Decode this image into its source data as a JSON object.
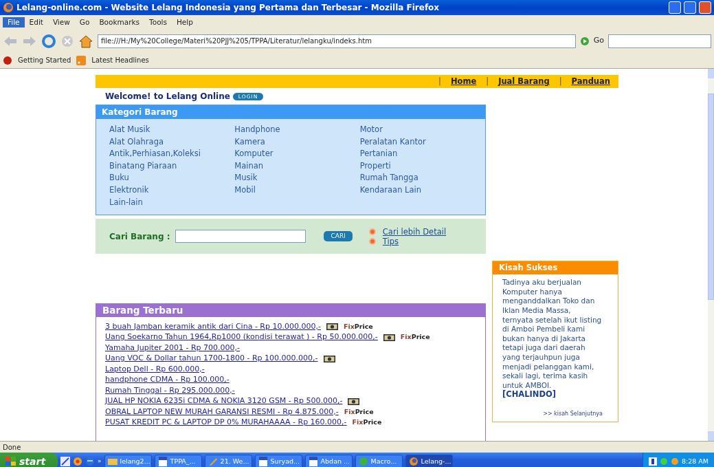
{
  "window": {
    "title": "Lelang-online.com - Website Lelang Indonesia yang Pertama dan Terbesar - Mozilla Firefox"
  },
  "menu": [
    {
      "label": "File",
      "selected": true
    },
    {
      "label": "Edit",
      "selected": false
    },
    {
      "label": "View",
      "selected": false
    },
    {
      "label": "Go",
      "selected": false
    },
    {
      "label": "Bookmarks",
      "selected": false
    },
    {
      "label": "Tools",
      "selected": false
    },
    {
      "label": "Help",
      "selected": false
    }
  ],
  "address": {
    "value": "file:///H:/My%20College/Materi%20PJJ%205/TPPA/Literatur/lelangku/indeks.htm",
    "go": "Go"
  },
  "bookmarks": [
    {
      "label": "Getting Started",
      "kind": "page"
    },
    {
      "label": "Latest Headlines",
      "kind": "feed"
    }
  ],
  "page": {
    "nav": [
      {
        "separator": "|",
        "label": "Home"
      },
      {
        "separator": "|",
        "label": "Jual Barang"
      },
      {
        "separator": "|",
        "label": "Panduan"
      }
    ],
    "welcome": "Welcome! to Lelang Online",
    "login": "LOGIN",
    "kategori": {
      "title": "Kategori Barang",
      "columns": [
        [
          "Alat Musik",
          "Alat Olahraga",
          "Antik,Perhiasan,Koleksi",
          "Binatang Piaraan",
          "Buku",
          "Elektronik",
          "Lain-lain"
        ],
        [
          "Handphone",
          "Kamera",
          "Komputer",
          "Mainan",
          "Musik",
          "Mobil"
        ],
        [
          "Motor",
          "Peralatan Kantor",
          "Pertanian",
          "Properti",
          "Rumah Tangga",
          "Kendaraan Lain"
        ]
      ]
    },
    "search": {
      "label": "Cari Barang :",
      "button": "CARI",
      "links": [
        "Cari lebih Detail",
        "Tips"
      ]
    },
    "terbaru": {
      "title": "Barang Terbaru",
      "items": [
        {
          "text": "3 buah Jamban keramik antik dari Cina - Rp 10.000.000,-",
          "photo": true,
          "fix": "Fix",
          "price": "Price"
        },
        {
          "text": "Uang Soekarno Tahun 1964,Rp1000 (kondisi terawat ) - Rp 50.000.000,-",
          "photo": true,
          "fix": "Fix",
          "price": "Price"
        },
        {
          "text": "Yamaha Jupiter 2001 - Rp 700.000,-",
          "photo": false
        },
        {
          "text": "Uang VOC & Dollar tahun 1700-1800 - Rp 100.000.000,-",
          "photo": true
        },
        {
          "text": "Laptop Dell - Rp 600.000,-",
          "photo": false
        },
        {
          "text": "handphone CDMA - Rp 100.000,-",
          "photo": false
        },
        {
          "text": "Rumah Tinggal - Rp 295.000.000,-",
          "photo": false
        },
        {
          "text": "JUAL HP NOKIA 6235i CDMA & NOKIA 3120 GSM - Rp 500.000,-",
          "photo": true
        },
        {
          "text": "OBRAL LAPTOP NEW MURAH GARANSI RESMI - Rp 4.875.000,-",
          "photo": false,
          "fix": "Fix",
          "price": "Price"
        },
        {
          "text": "PUSAT KREDIT PC & LAPTOP DP 0% MURAHAAAA - Rp 160.000,-",
          "photo": false,
          "fix": "Fix",
          "price": "Price"
        }
      ]
    },
    "kisah": {
      "title": "Kisah Sukses",
      "story": "Tadinya aku berjualan Komputer hanya menganddalkan Toko dan Iklan Media Massa, ternyata setelah ikut listing di Amboi Pembeli kami bukan hanya di Jakarta tetapi juga dari daerah yang terjauhpun juga menjadi pelanggan kami, sekali lagi, terima kasih untuk AMBOI.",
      "author": "[CHALINDO]",
      "more": ">> kisah Selanjutnya"
    }
  },
  "status_bar": "Done",
  "taskbar": {
    "start": "start",
    "more": "»",
    "tasks": [
      {
        "label": "lelang2...",
        "kind": "folder",
        "selected": false
      },
      {
        "label": "TPPA_...",
        "kind": "doc",
        "selected": false
      },
      {
        "label": "21. We...",
        "kind": "tool",
        "selected": false
      },
      {
        "label": "Suryad...",
        "kind": "doc",
        "selected": false
      },
      {
        "label": "Abdan ...",
        "kind": "doc",
        "selected": false
      },
      {
        "label": "Macro...",
        "kind": "app",
        "selected": false
      },
      {
        "label": "Lelang-...",
        "kind": "browser",
        "selected": true
      }
    ],
    "clock": "8:28 AM"
  }
}
